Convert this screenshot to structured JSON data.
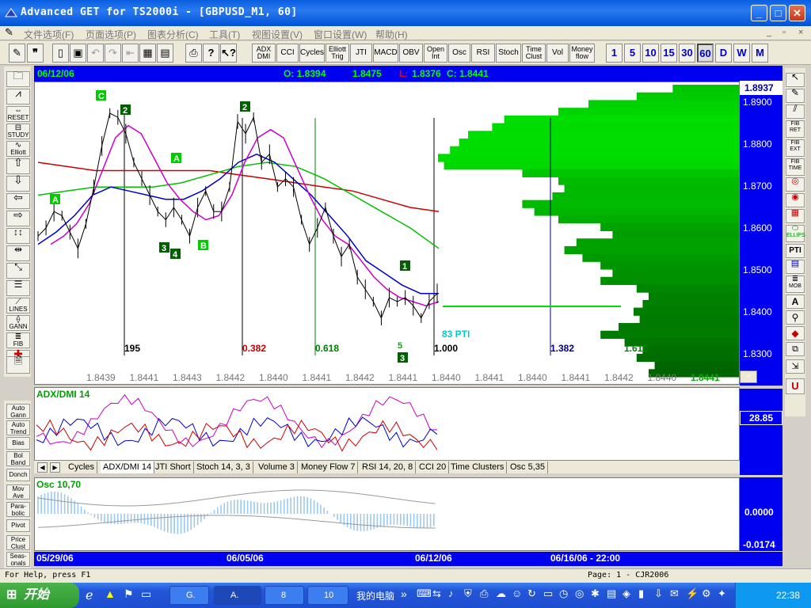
{
  "window": {
    "title": "Advanced GET for TS2000i - [GBPUSD_M1, 60]",
    "minimize": "_",
    "maximize": "□",
    "close": "✕"
  },
  "menubar": {
    "items": [
      "文件选项(F)",
      "页面选项(P)",
      "图表分析(C)",
      "工具(T)",
      "视图设置(V)",
      "窗口设置(W)",
      "帮助(H)"
    ],
    "mdi_controls": [
      "_",
      "▫",
      "×"
    ]
  },
  "toolbar": {
    "indicator_buttons": [
      "ADX\nDMI",
      "CCI",
      "Cycles",
      "Elliott\nTrig",
      "JTI",
      "MACD",
      "OBV",
      "Open\nInt",
      "Osc",
      "RSI",
      "Stoch",
      "Time\nClust",
      "Vol",
      "Money\nflow"
    ],
    "interval_buttons": [
      "1",
      "5",
      "10",
      "15",
      "30",
      "60",
      "D",
      "W",
      "M"
    ],
    "selected_interval": "60"
  },
  "left_tools": [
    "RESET",
    "STUDY",
    "Elliott",
    "LINES",
    "GANN",
    "FIB"
  ],
  "left_indicators": [
    "Auto\nGann",
    "Auto\nTrend",
    "Bias",
    "Bol\nBand",
    "Donch",
    "Mov\nAve",
    "Para-\nbolic",
    "Pivot",
    "Price\nClust",
    "Seas-\nonals"
  ],
  "right_tools": [
    "FIB\nRET",
    "FIB\nEXT",
    "FIB\nTIME",
    "ELLIPS",
    "PTI",
    "MOB"
  ],
  "chart_header": {
    "date": "06/12/06",
    "open": "O: 1.8394",
    "high": "1.8475",
    "low_label": "L:",
    "low": "1.8376",
    "close": "C: 1.8441"
  },
  "price_axis": {
    "current": "1.8937",
    "ticks": [
      "1.8900",
      "1.8800",
      "1.8700",
      "1.8600",
      "1.8500",
      "1.8400",
      "1.8300"
    ]
  },
  "chart_data": {
    "type": "line",
    "series_label_colors": {
      "price": "#000000",
      "ma_fast": "#cc00cc",
      "ma_blue": "#0000cc",
      "ma_green": "#00cc00",
      "ma_red": "#cc0000"
    },
    "ylim": [
      1.825,
      1.894
    ],
    "price": [
      1.858,
      1.86,
      1.864,
      1.863,
      1.859,
      1.855,
      1.861,
      1.87,
      1.88,
      1.888,
      1.887,
      1.883,
      1.876,
      1.872,
      1.868,
      1.864,
      1.862,
      1.865,
      1.862,
      1.858,
      1.865,
      1.869,
      1.864,
      1.864,
      1.87,
      1.886,
      1.883,
      1.887,
      1.876,
      1.878,
      1.87,
      1.872,
      1.87,
      1.862,
      1.856,
      1.86,
      1.865,
      1.858,
      1.853,
      1.856,
      1.848,
      1.845,
      1.842,
      1.838,
      1.843,
      1.842,
      1.843,
      1.841,
      1.838,
      1.842,
      1.844
    ],
    "ma_fast": [
      1.856,
      1.858,
      1.861,
      1.866,
      1.874,
      1.882,
      1.885,
      1.883,
      1.877,
      1.871,
      1.867,
      1.864,
      1.862,
      1.863,
      1.868,
      1.876,
      1.882,
      1.884,
      1.882,
      1.875,
      1.868,
      1.862,
      1.858,
      1.856,
      1.852,
      1.848,
      1.845,
      1.843,
      1.842,
      1.841,
      1.842
    ],
    "ma_blue": [
      1.856,
      1.859,
      1.863,
      1.868,
      1.87,
      1.869,
      1.868,
      1.867,
      1.867,
      1.869,
      1.872,
      1.876,
      1.878,
      1.876,
      1.872,
      1.868,
      1.863,
      1.858,
      1.852,
      1.849,
      1.846,
      1.844,
      1.844
    ],
    "ma_green": [
      1.868,
      1.869,
      1.87,
      1.87,
      1.87,
      1.871,
      1.873,
      1.875,
      1.876,
      1.875,
      1.872,
      1.868,
      1.864,
      1.86,
      1.855
    ],
    "ma_red": [
      1.876,
      1.875,
      1.874,
      1.874,
      1.874,
      1.874,
      1.874,
      1.873,
      1.872,
      1.871,
      1.87,
      1.869,
      1.867,
      1.865,
      1.864
    ],
    "volume_profile": [
      0.22,
      0.34,
      0.5,
      0.6,
      0.78,
      0.82,
      0.9,
      0.93,
      0.96,
      1.0,
      0.98,
      0.72,
      0.6,
      0.58,
      0.62,
      0.72,
      0.68,
      0.6,
      0.46,
      0.42,
      0.54,
      0.58,
      0.52,
      0.46,
      0.42,
      0.46,
      0.34,
      0.3,
      0.32,
      0.35,
      0.33,
      0.4,
      0.46,
      0.38,
      0.32,
      0.34,
      0.28,
      0.3
    ]
  },
  "fib_time": {
    "labels": [
      "195",
      "0.382",
      "0.618",
      "1.000",
      "1.382",
      "1.618"
    ],
    "pti": "83 PTI"
  },
  "elliott_labels": [
    "C",
    "2",
    "A",
    "A",
    "3",
    "4",
    "B",
    "2",
    "3",
    "5",
    "1"
  ],
  "price_row": [
    "1.8439",
    "1.8441",
    "1.8443",
    "1.8442",
    "1.8440",
    "1.8441",
    "1.8442",
    "1.8441",
    "1.8440",
    "1.8441",
    "1.8440",
    "1.8441",
    "1.8442",
    "1.8440",
    "1.8441"
  ],
  "adx_pane": {
    "title": "ADX/DMI 14",
    "current": "28.85"
  },
  "tabs": [
    "Cycles",
    "ADX/DMI 14",
    "JTI Short",
    "Stoch 14, 3, 3",
    "Volume 3",
    "Money Flow 7",
    "RSI 14, 20, 8",
    "CCI 20",
    "Time Clusters",
    "Osc 5,35"
  ],
  "active_tab": "ADX/DMI 14",
  "osc_pane": {
    "title": "Osc 10,70",
    "value": "0.0000",
    "bottom_value": "-0.0174"
  },
  "date_axis": {
    "labels": [
      "05/29/06",
      "06/05/06",
      "06/12/06",
      "06/16/06 - 22:00"
    ]
  },
  "statusbar": {
    "help": "For Help, press F1",
    "page": "Page: 1 - CJR2006"
  },
  "taskbar": {
    "start": "开始",
    "tasks": [
      "G.",
      "A.",
      "8",
      "10",
      "我的电脑"
    ],
    "clock": "22:38"
  },
  "colors": {
    "axis_blue": "#0000f0",
    "header_green": "#00ff00",
    "title_blue": "#0a5ee0"
  }
}
